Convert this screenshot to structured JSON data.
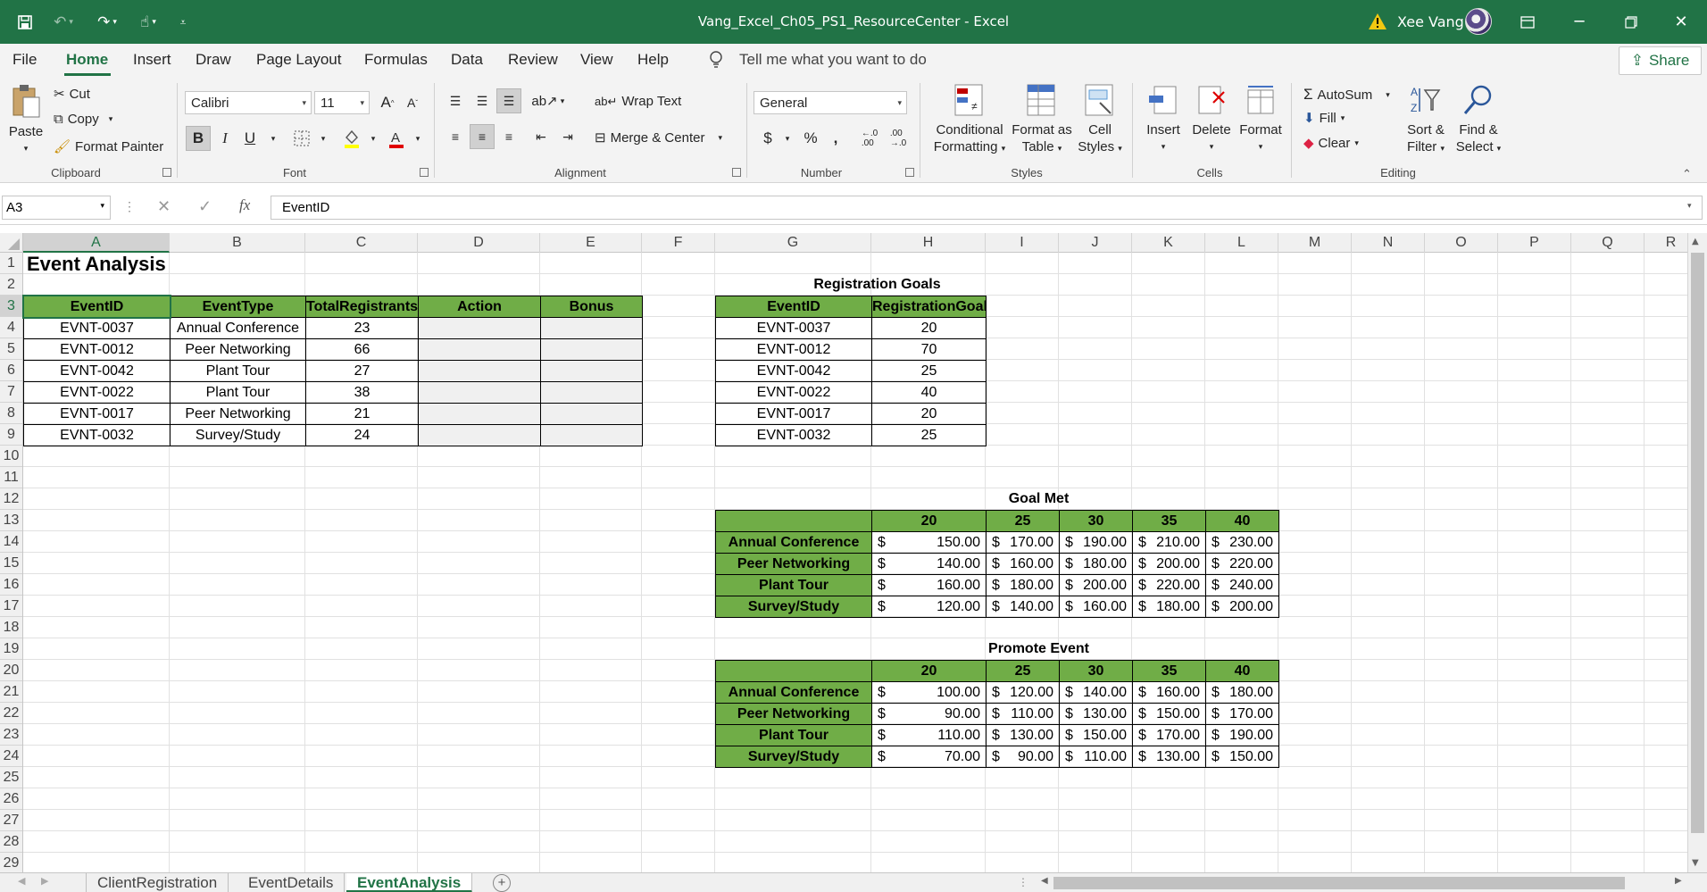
{
  "titlebar": {
    "document_title": "Vang_Excel_Ch05_PS1_ResourceCenter  -  Excel",
    "user_name": "Xee Vang",
    "colors": {
      "accent": "#217346",
      "header_fill": "#70ad47"
    }
  },
  "menu": {
    "tabs": [
      "File",
      "Home",
      "Insert",
      "Draw",
      "Page Layout",
      "Formulas",
      "Data",
      "Review",
      "View",
      "Help"
    ],
    "active_tab": "Home",
    "tell_me": "Tell me what you want to do",
    "share": "Share"
  },
  "ribbon": {
    "clipboard": {
      "label": "Clipboard",
      "paste": "Paste",
      "cut": "Cut",
      "copy": "Copy",
      "format_painter": "Format Painter"
    },
    "font": {
      "label": "Font",
      "font_name": "Calibri",
      "font_size": "11"
    },
    "alignment": {
      "label": "Alignment",
      "wrap_text": "Wrap Text",
      "merge_center": "Merge & Center"
    },
    "number": {
      "label": "Number",
      "format": "General",
      "currency": "$",
      "percent": "%",
      "comma": ","
    },
    "styles": {
      "label": "Styles",
      "conditional_1": "Conditional",
      "conditional_2": "Formatting",
      "format_table_1": "Format as",
      "format_table_2": "Table",
      "cell_styles_1": "Cell",
      "cell_styles_2": "Styles"
    },
    "cells": {
      "label": "Cells",
      "insert": "Insert",
      "delete": "Delete",
      "format": "Format"
    },
    "editing": {
      "label": "Editing",
      "autosum": "AutoSum",
      "fill": "Fill",
      "clear": "Clear",
      "sort_1": "Sort &",
      "sort_2": "Filter",
      "find_1": "Find &",
      "find_2": "Select"
    }
  },
  "formula_bar": {
    "name_box": "A3",
    "fx": "fx",
    "content": "EventID"
  },
  "grid": {
    "columns": [
      "A",
      "B",
      "C",
      "D",
      "E",
      "F",
      "G",
      "H",
      "I",
      "J",
      "K",
      "L",
      "M",
      "N",
      "O",
      "P",
      "Q",
      "R"
    ],
    "rows": [
      "1",
      "2",
      "3",
      "4",
      "5",
      "6",
      "7",
      "8",
      "9",
      "10",
      "11",
      "12",
      "13",
      "14",
      "15",
      "16",
      "17",
      "18",
      "19",
      "20",
      "21",
      "22",
      "23",
      "24",
      "25",
      "26",
      "27",
      "28",
      "29"
    ],
    "selected_cell": "A3"
  },
  "sheet": {
    "title": "Event Analysis",
    "main_table": {
      "headers": [
        "EventID",
        "EventType",
        "TotalRegistrants",
        "Action",
        "Bonus"
      ],
      "rows": [
        [
          "EVNT-0037",
          "Annual Conference",
          "23"
        ],
        [
          "EVNT-0012",
          "Peer Networking",
          "66"
        ],
        [
          "EVNT-0042",
          "Plant Tour",
          "27"
        ],
        [
          "EVNT-0022",
          "Plant Tour",
          "38"
        ],
        [
          "EVNT-0017",
          "Peer Networking",
          "21"
        ],
        [
          "EVNT-0032",
          "Survey/Study",
          "24"
        ]
      ]
    },
    "goals": {
      "title": "Registration Goals",
      "headers": [
        "EventID",
        "RegistrationGoal"
      ],
      "rows": [
        [
          "EVNT-0037",
          "20"
        ],
        [
          "EVNT-0012",
          "70"
        ],
        [
          "EVNT-0042",
          "25"
        ],
        [
          "EVNT-0022",
          "40"
        ],
        [
          "EVNT-0017",
          "20"
        ],
        [
          "EVNT-0032",
          "25"
        ]
      ]
    },
    "goal_met": {
      "title": "Goal Met",
      "cols": [
        "20",
        "25",
        "30",
        "35",
        "40"
      ],
      "rows": [
        {
          "label": "Annual Conference",
          "values": [
            "150.00",
            "170.00",
            "190.00",
            "210.00",
            "230.00"
          ]
        },
        {
          "label": "Peer Networking",
          "values": [
            "140.00",
            "160.00",
            "180.00",
            "200.00",
            "220.00"
          ]
        },
        {
          "label": "Plant Tour",
          "values": [
            "160.00",
            "180.00",
            "200.00",
            "220.00",
            "240.00"
          ]
        },
        {
          "label": "Survey/Study",
          "values": [
            "120.00",
            "140.00",
            "160.00",
            "180.00",
            "200.00"
          ]
        }
      ]
    },
    "promote": {
      "title": "Promote Event",
      "cols": [
        "20",
        "25",
        "30",
        "35",
        "40"
      ],
      "rows": [
        {
          "label": "Annual Conference",
          "values": [
            "100.00",
            "120.00",
            "140.00",
            "160.00",
            "180.00"
          ]
        },
        {
          "label": "Peer Networking",
          "values": [
            "90.00",
            "110.00",
            "130.00",
            "150.00",
            "170.00"
          ]
        },
        {
          "label": "Plant Tour",
          "values": [
            "110.00",
            "130.00",
            "150.00",
            "170.00",
            "190.00"
          ]
        },
        {
          "label": "Survey/Study",
          "values": [
            "70.00",
            "90.00",
            "110.00",
            "130.00",
            "150.00"
          ]
        }
      ]
    },
    "currency": "$"
  },
  "sheet_tabs": [
    "ClientRegistration",
    "EventDetails",
    "EventAnalysis"
  ],
  "active_sheet": "EventAnalysis"
}
